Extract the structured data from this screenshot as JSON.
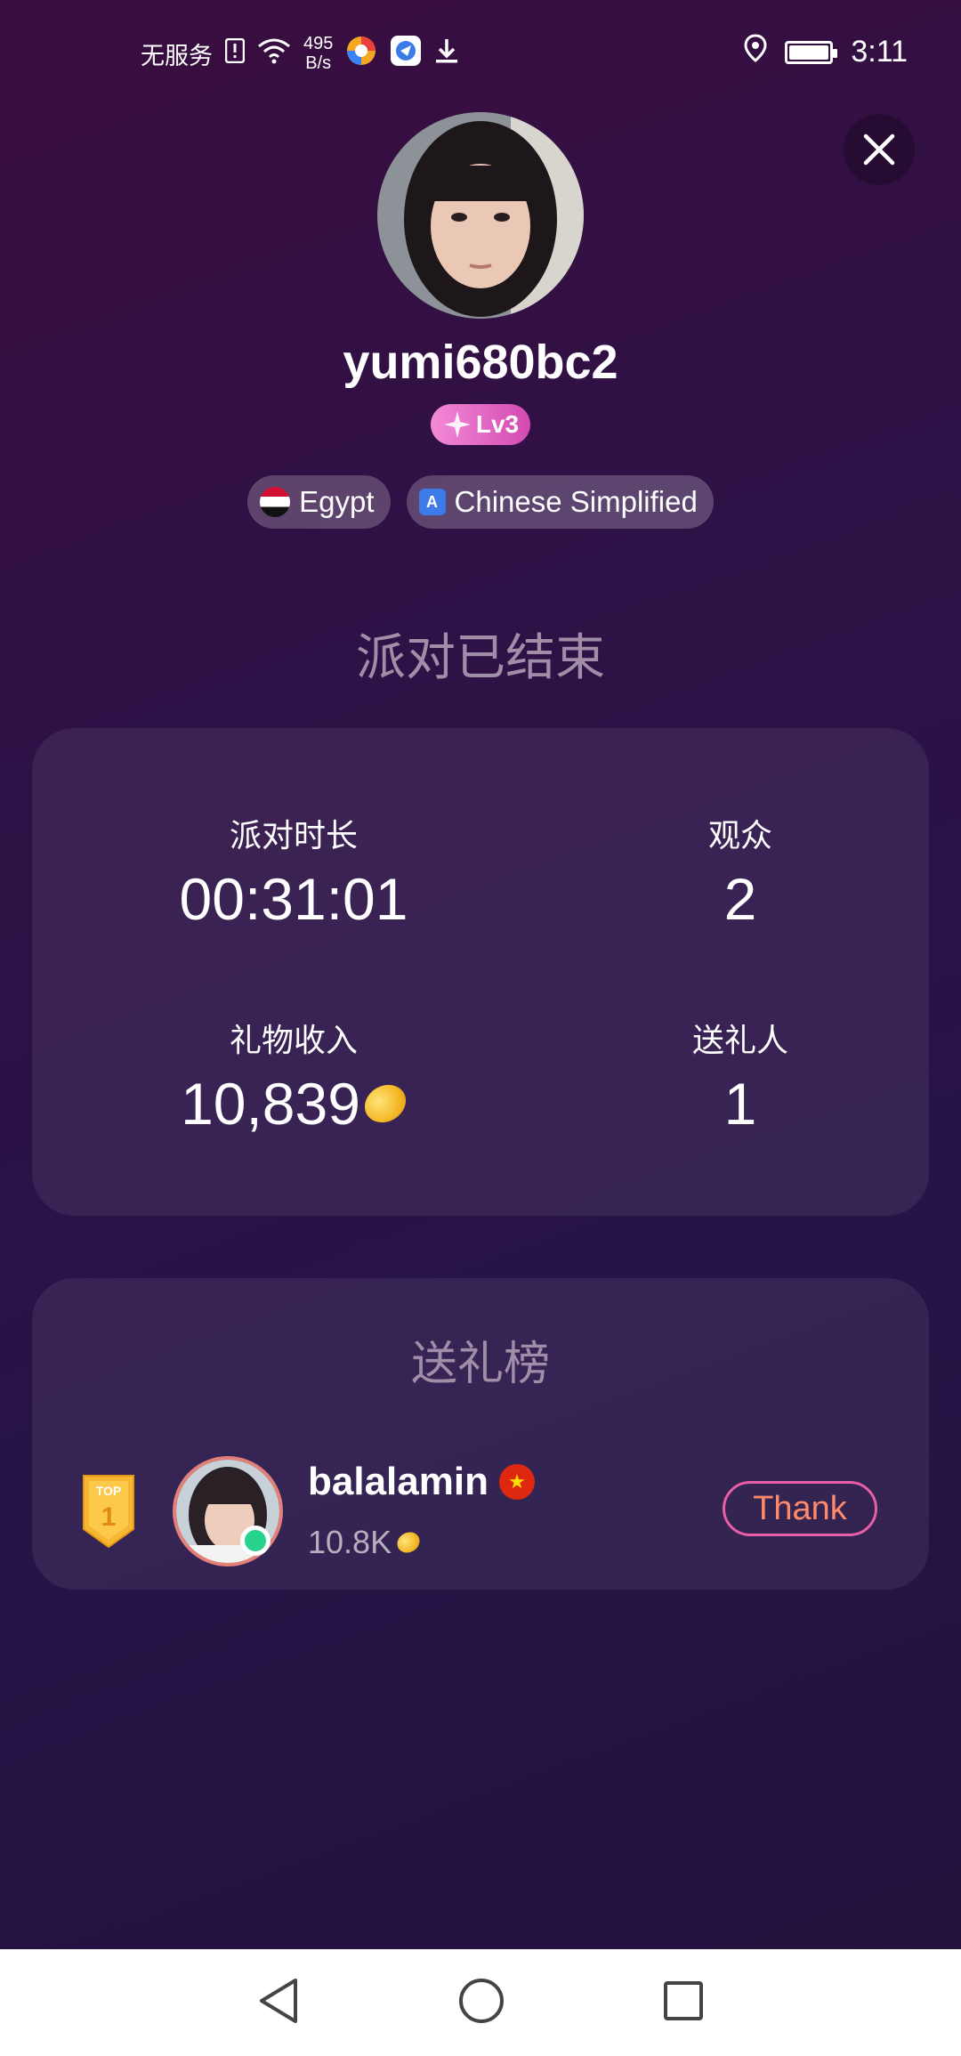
{
  "status_bar": {
    "carrier": "无服务",
    "speed_value": "495",
    "speed_unit": "B/s",
    "time": "3:11"
  },
  "profile": {
    "username": "yumi680bc2",
    "level": "Lv3",
    "country": "Egypt",
    "language": "Chinese Simplified"
  },
  "party": {
    "ended_title": "派对已结束",
    "stats": [
      {
        "label": "派对时长",
        "value": "00:31:01"
      },
      {
        "label": "观众",
        "value": "2"
      },
      {
        "label": "礼物收入",
        "value": "10,839"
      },
      {
        "label": "送礼人",
        "value": "1"
      }
    ]
  },
  "ranking": {
    "title": "送礼榜",
    "items": [
      {
        "rank": "1",
        "top_label": "TOP",
        "name": "balalamin",
        "amount": "10.8K",
        "button": "Thank"
      }
    ]
  },
  "colors": {
    "level_badge": "#e06cc8",
    "thank_border": "#e85fa6",
    "online": "#28d38e"
  }
}
